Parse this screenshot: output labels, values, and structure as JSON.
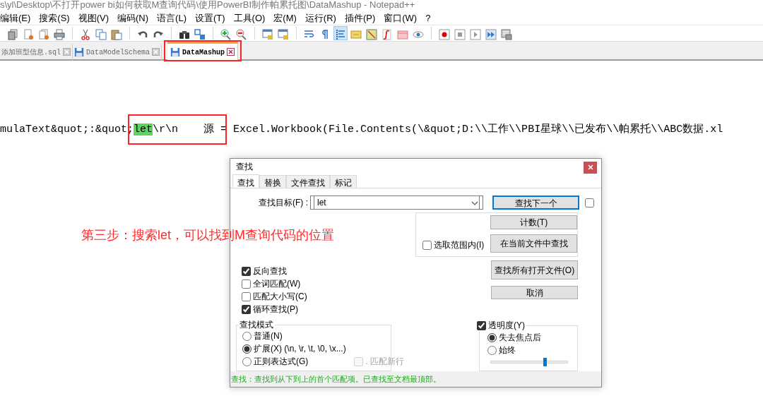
{
  "window": {
    "title": "s\\yl\\Desktop\\不打开power bi如何获取M查询代码\\使用PowerBI制作帕累托图\\DataMashup - Notepad++"
  },
  "menu": [
    "编辑(E)",
    "搜索(S)",
    "视图(V)",
    "编码(N)",
    "语言(L)",
    "设置(T)",
    "工具(O)",
    "宏(M)",
    "运行(R)",
    "插件(P)",
    "窗口(W)",
    "?"
  ],
  "toolbar": {
    "indent_guide_on": true
  },
  "tabs": [
    {
      "label": "添加班型信息.sql",
      "selected": false
    },
    {
      "label": "DataModelSchema",
      "selected": false
    },
    {
      "label": "DataMashup",
      "selected": true
    }
  ],
  "editor": {
    "before": "mulaText&quot;:&quot;",
    "match": "let",
    "after": "\\r\\n    源 = Excel.Workbook(File.Contents(\\&quot;D:\\\\工作\\\\PBI星球\\\\已发布\\\\帕累托\\\\ABC数据.xl"
  },
  "annotation": "第三步：搜索let，可以找到M查询代码的位置",
  "dialog": {
    "title": "查找",
    "tabs": [
      {
        "label": "查找",
        "selected": true
      },
      {
        "label": "替换",
        "selected": false
      },
      {
        "label": "文件查找",
        "selected": false
      },
      {
        "label": "标记",
        "selected": false
      }
    ],
    "find_field": {
      "label": "查找目标(F) :",
      "value": "let"
    },
    "find_next_button": "查找下一个",
    "side_checkbox": {
      "checked": false
    },
    "in_selection": {
      "label": "选取范围内(I)",
      "checked": false
    },
    "count_button": "计数(T)",
    "find_in_current_button": "在当前文件中查找",
    "find_all_open_button": "查找所有打开文件(O)",
    "cancel_button": "取消",
    "options": [
      {
        "label": "反向查找",
        "checked": true
      },
      {
        "label": "全词匹配(W)",
        "checked": false
      },
      {
        "label": "匹配大小写(C)",
        "checked": false
      },
      {
        "label": "循环查找(P)",
        "checked": true
      }
    ],
    "search_mode": {
      "title": "查找模式",
      "options": [
        {
          "label": "普通(N)",
          "selected": false
        },
        {
          "label": "扩展(X) (\\n, \\r, \\t, \\0, \\x...)",
          "selected": true
        },
        {
          "label": "正则表达式(G)",
          "selected": false
        }
      ],
      "dot_newline": {
        "label": ". 匹配新行",
        "checked": false,
        "disabled": true
      }
    },
    "transparency": {
      "label": "透明度(Y)",
      "checked": true,
      "options": [
        {
          "label": "失去焦点后",
          "selected": true
        },
        {
          "label": "始终",
          "selected": false
        }
      ],
      "level": 0.7
    },
    "status": "查找：查找到从下到上的首个匹配项。已查找至文档最顶部。"
  }
}
